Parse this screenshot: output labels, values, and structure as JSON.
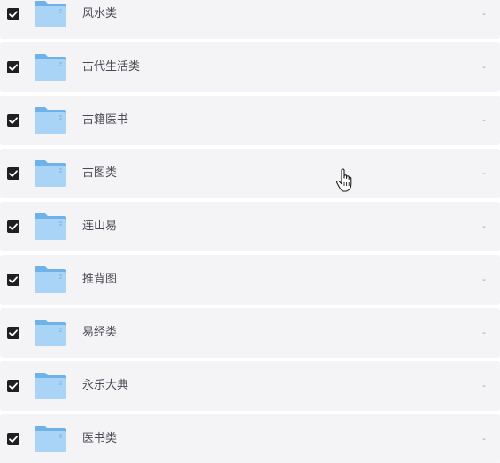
{
  "rows": [
    {
      "name": "风水类",
      "size": "-",
      "checked": true
    },
    {
      "name": "古代生活类",
      "size": "-",
      "checked": true
    },
    {
      "name": "古籍医书",
      "size": "-",
      "checked": true
    },
    {
      "name": "古图类",
      "size": "-",
      "checked": true
    },
    {
      "name": "连山易",
      "size": "-",
      "checked": true
    },
    {
      "name": "推背图",
      "size": "-",
      "checked": true
    },
    {
      "name": "易经类",
      "size": "-",
      "checked": true
    },
    {
      "name": "永乐大典",
      "size": "-",
      "checked": true
    },
    {
      "name": "医书类",
      "size": "-",
      "checked": true
    }
  ],
  "icons": {
    "checkbox": "checkbox-checked-icon",
    "folder": "folder-icon",
    "cursor": "hand-pointer-icon"
  },
  "colors": {
    "row_bg": "#f4f4f6",
    "checkbox": "#1f1f1f",
    "folder_light": "#a9d4f6",
    "folder_dark": "#6fb2ea"
  }
}
